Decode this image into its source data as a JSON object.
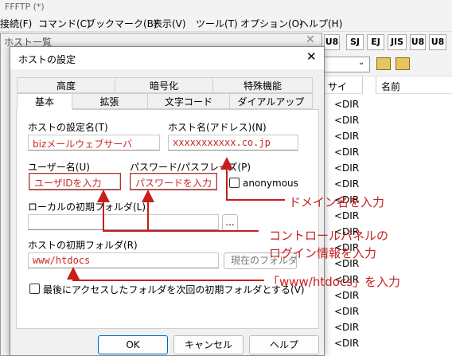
{
  "app": {
    "title": "FFFTP (*)"
  },
  "menubar": [
    "接続(F)",
    "コマンド(C)",
    "ブックマーク(B)",
    "表示(V)",
    "ツール(T)",
    "オプション(O)",
    "ヘルプ(H)"
  ],
  "toolbar": [
    "U8",
    "SJ",
    "EJ",
    "JIS",
    "U8",
    "U8"
  ],
  "remote": {
    "col_size": "サイ",
    "col_name": "名前",
    "dir_label": "<DIR"
  },
  "hostlist": {
    "title": "ホスト一覧"
  },
  "dialog": {
    "title": "ホストの設定",
    "tabs_row1": [
      "高度",
      "暗号化",
      "特殊機能"
    ],
    "tabs_row2": [
      "基本",
      "拡張",
      "文字コード",
      "ダイアルアップ"
    ],
    "active_tab": "基本",
    "host_setting_name_label": "ホストの設定名(T)",
    "host_setting_name_value": "bizメールウェブサーバ",
    "host_name_label": "ホスト名(アドレス)(N)",
    "host_name_value": "xxxxxxxxxxx.co.jp",
    "user_label": "ユーザー名(U)",
    "user_value": "ユーザIDを入力",
    "password_label": "パスワード/パスフレーズ(P)",
    "password_value": "パスワードを入力",
    "anonymous_label": "anonymous",
    "local_folder_label": "ローカルの初期フォルダ(L)",
    "local_folder_value": "",
    "browse_label": "...",
    "host_folder_label": "ホストの初期フォルダ(R)",
    "host_folder_value": "www/htdocs",
    "current_folder_button": "現在のフォルダ",
    "last_folder_checkbox": "最後にアクセスしたフォルダを次回の初期フォルダとする(V)",
    "ok": "OK",
    "cancel": "キャンセル",
    "help": "ヘルプ"
  },
  "annotations": {
    "domain": "ドメイン名を入力",
    "cpanel_line1": "コントロールパネルの",
    "cpanel_line2": "ログイン情報を入力",
    "htdocs": "「www/htdocs」を入力"
  },
  "colors": {
    "annotation": "#c81e1e",
    "accent": "#0067c0"
  }
}
